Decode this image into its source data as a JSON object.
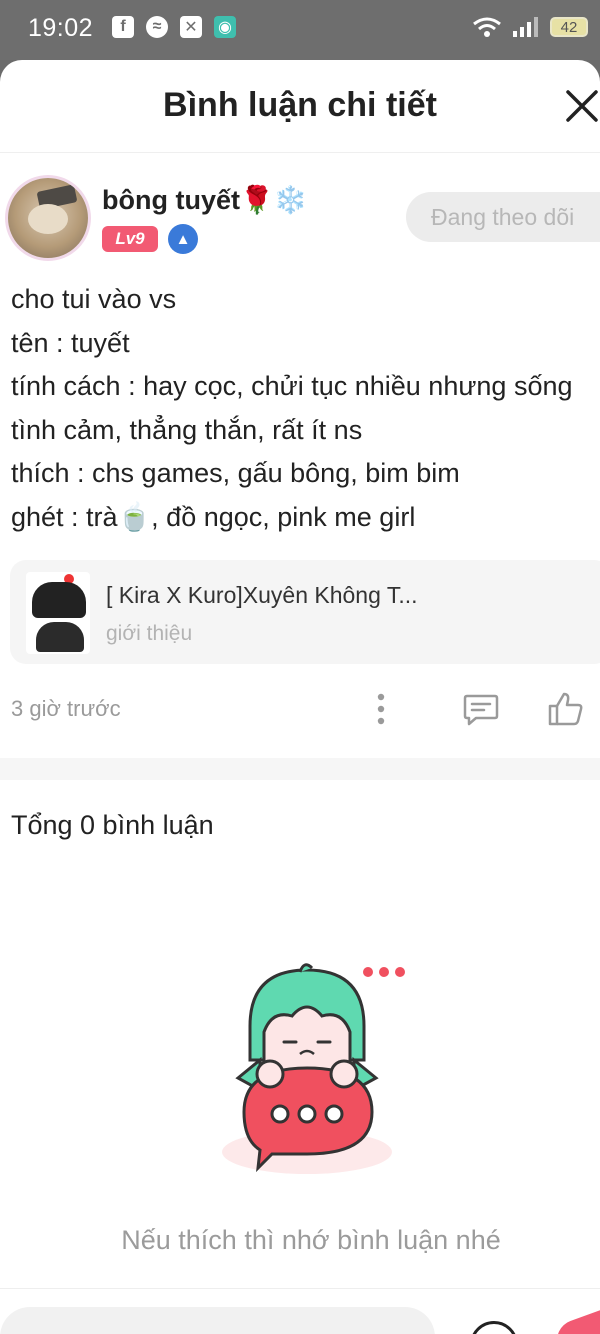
{
  "status_bar": {
    "time": "19:02",
    "app_icons": [
      "facebook-icon",
      "messenger-icon",
      "capcut-icon",
      "app-icon"
    ],
    "battery": "42"
  },
  "header": {
    "title": "Bình luận chi tiết",
    "close_icon": "close-icon"
  },
  "author": {
    "name": "bông tuyết🌹❄️",
    "level": "Lv9",
    "follow_label": "Đang theo dõi"
  },
  "post": {
    "lines": [
      "cho tui vào vs",
      "tên : tuyết",
      "tính cách : hay cọc, chửi tục nhiều nhưng sống",
      "tình cảm, thẳng thắn, rất ít ns",
      "thích : chs games, gấu bông, bim bim",
      "ghét : trà🍵, đồ ngọc, pink me girl"
    ]
  },
  "book": {
    "title": "[ Kira X Kuro]Xuyên Không T...",
    "subtitle": "giới thiệu"
  },
  "meta": {
    "time_ago": "3 giờ trước"
  },
  "comments": {
    "total_label": "Tổng 0 bình luận",
    "empty_message": "Nếu thích thì nhớ bình luận nhé"
  },
  "colors": {
    "accent": "#f25a73",
    "verify": "#3a7ad9",
    "mascot_hair": "#5fd9b0",
    "mascot_bubble": "#f0505f"
  }
}
